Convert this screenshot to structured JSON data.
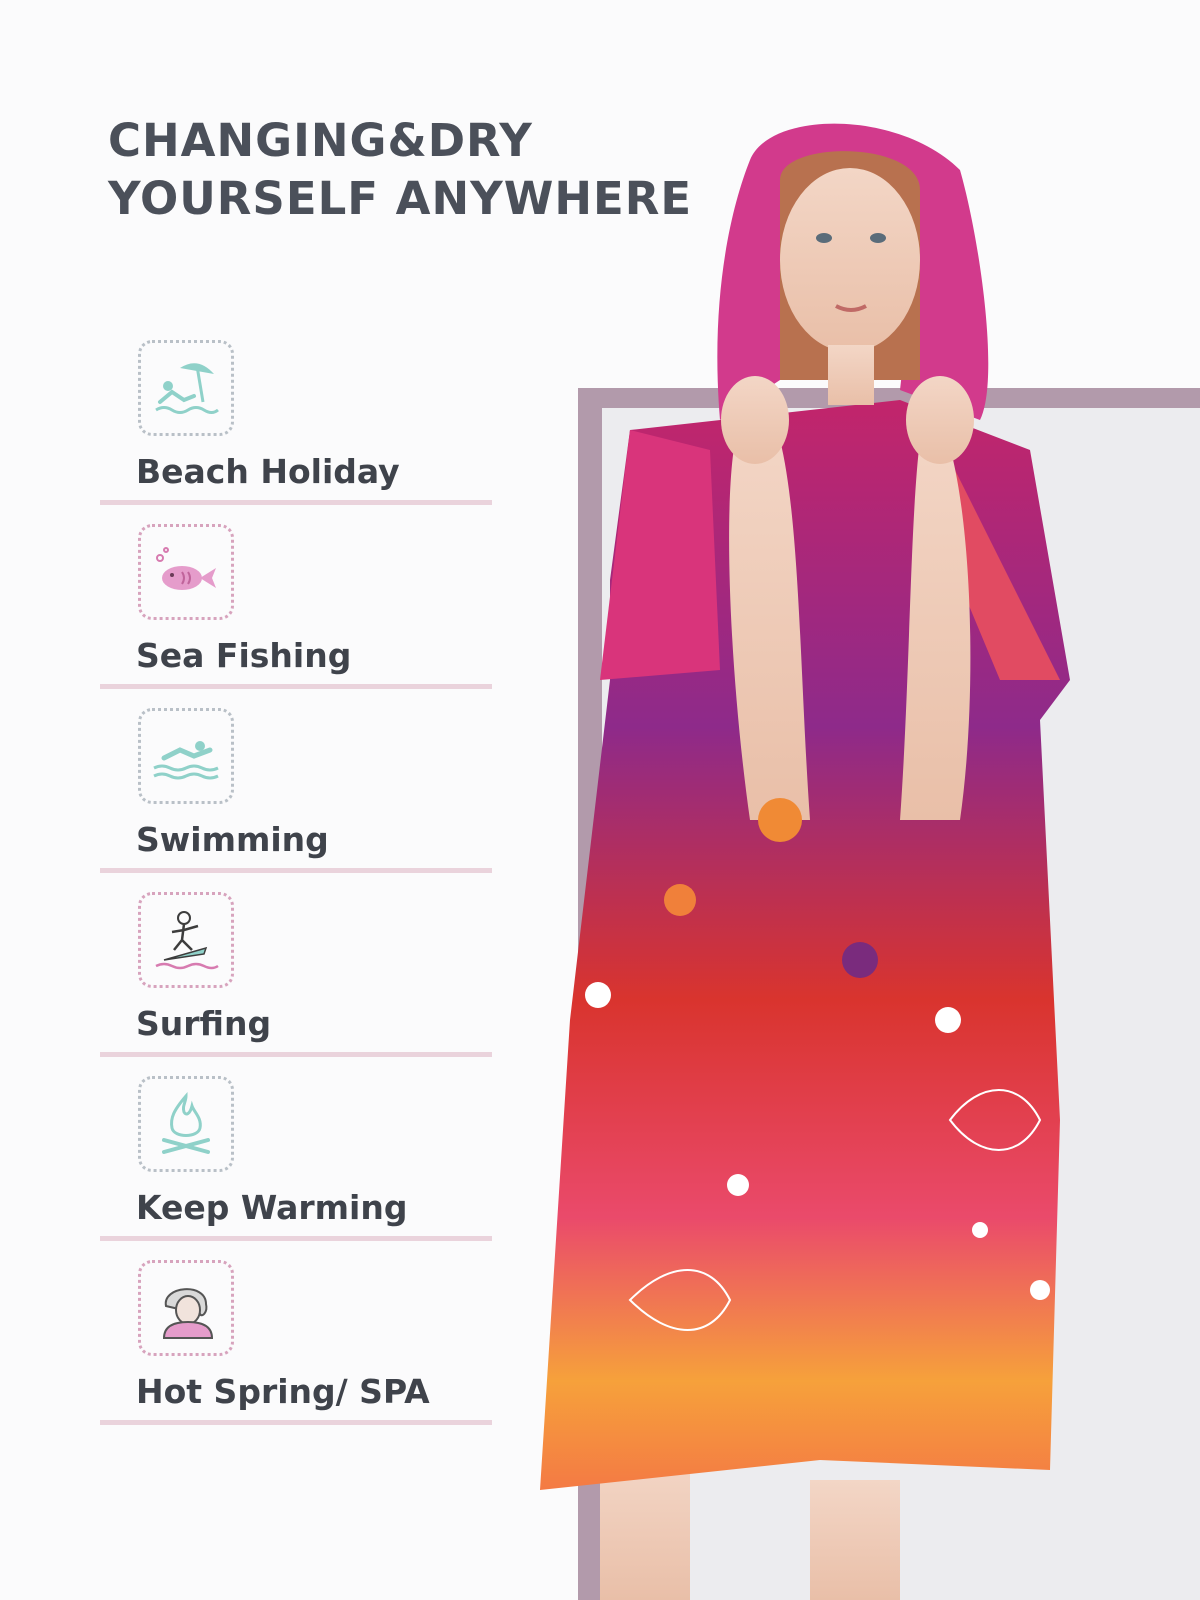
{
  "headline": {
    "line1": "CHANGING&DRY",
    "line2": "YOURSELF ANYWHERE"
  },
  "features": [
    {
      "label": "Beach Holiday",
      "icon": "beach-umbrella-icon"
    },
    {
      "label": "Sea Fishing",
      "icon": "fish-icon"
    },
    {
      "label": "Swimming",
      "icon": "swimmer-icon"
    },
    {
      "label": "Surfing",
      "icon": "surfer-icon"
    },
    {
      "label": "Keep Warming",
      "icon": "campfire-icon"
    },
    {
      "label": "Hot Spring/ SPA",
      "icon": "spa-person-icon"
    }
  ],
  "colors": {
    "accent_teal": "#8fd1c9",
    "accent_pink": "#d77bb0",
    "panel_mauve": "#b29aab",
    "divider": "#ead3dc",
    "text": "#3f434b"
  }
}
